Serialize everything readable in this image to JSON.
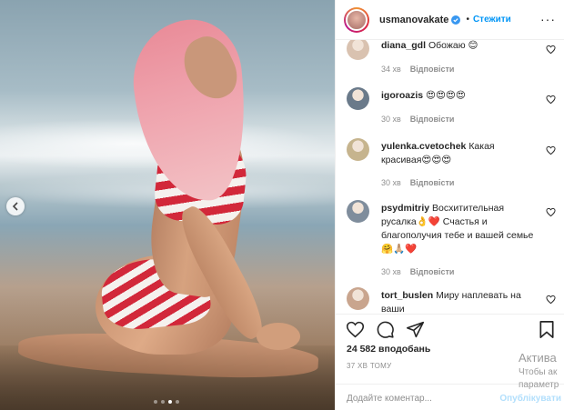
{
  "post": {
    "username": "usmanovakate",
    "follow_label": "Стежити",
    "separator": "•",
    "more_label": "···",
    "likes": "24 582 вподобань",
    "time_ago": "37 ХВ ТОМУ",
    "comment_placeholder": "Додайте коментар...",
    "publish_label": "Опублікувати",
    "carousel": {
      "total": 4,
      "active": 3
    }
  },
  "comments": [
    {
      "user": "diana_gdl",
      "text": "Обожаю 😊",
      "time": "34 хв",
      "reply": "Відповісти",
      "avatar_color": "#d9c2b0"
    },
    {
      "user": "igoroazis",
      "text": "😍😍😍😍",
      "time": "30 хв",
      "reply": "Відповісти",
      "avatar_color": "#6a7a8a"
    },
    {
      "user": "yulenka.cvetochek",
      "text": "Какая красивая😍😍😍",
      "time": "30 хв",
      "reply": "Відповісти",
      "avatar_color": "#c6b48e"
    },
    {
      "user": "psydmitriy",
      "text": "Восхитительная русалка👌❤️ Счастья и благополучия тебе и вашей семье🤗🙏🏼❤️",
      "time": "30 хв",
      "reply": "Відповісти",
      "avatar_color": "#7f8d9c"
    },
    {
      "user": "tort_buslen",
      "text": "Миру наплевать на ваши",
      "time": "",
      "reply": "",
      "avatar_color": "#c9a58e"
    }
  ],
  "watermark": {
    "line1": "Актива",
    "line2": "Чтобы ак",
    "line3": "параметр"
  },
  "colors": {
    "accent": "#0095f6",
    "stripe_red": "#d2283a",
    "hair_pink": "#efa4ae"
  }
}
